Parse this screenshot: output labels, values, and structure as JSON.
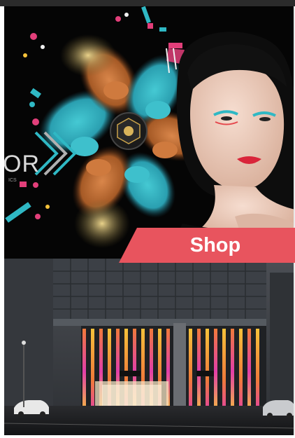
{
  "promo": {
    "shop_label": "Shop",
    "brand_fragment": "OR",
    "brand_subtext": "ICS"
  },
  "colors": {
    "ribbon": "#e8545e",
    "teal": "#2fb8c4",
    "copper": "#c8743a",
    "neon_pink": "#e23fa8",
    "neon_yellow": "#f6c23a"
  },
  "icons": [
    "chevron-decor-icon"
  ]
}
